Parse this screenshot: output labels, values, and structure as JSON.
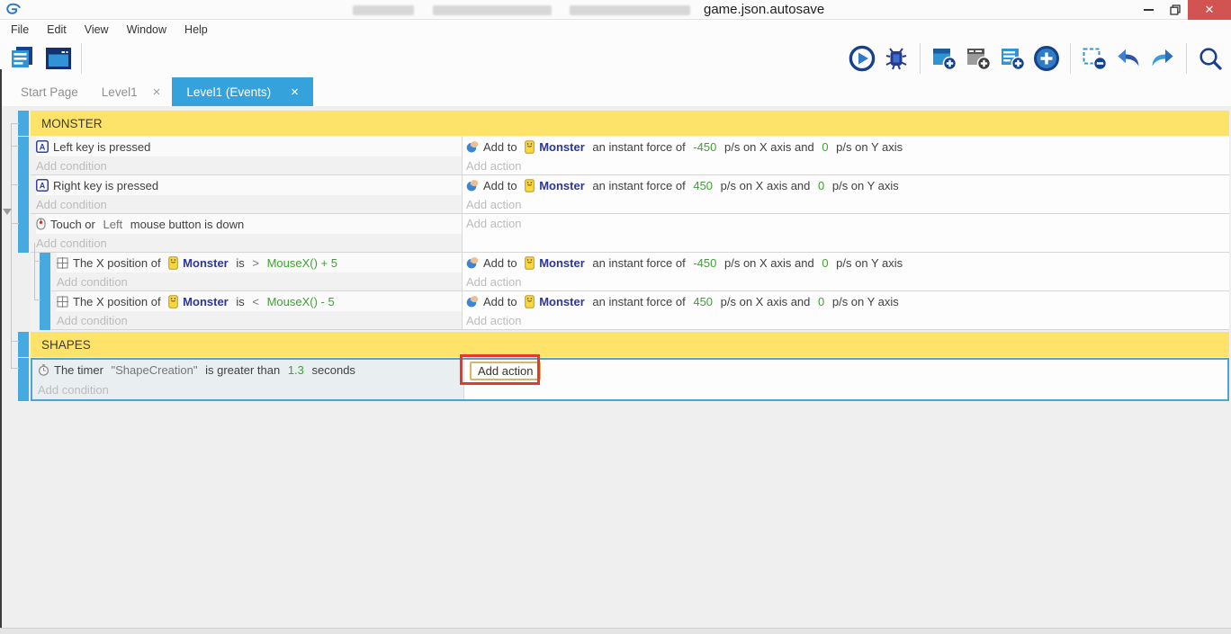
{
  "titlebar": {
    "visible_title": "game.json.autosave",
    "window_controls": [
      "minimize-icon",
      "restore-icon",
      "close-icon"
    ],
    "close_glyph": "✕"
  },
  "menubar": [
    "File",
    "Edit",
    "View",
    "Window",
    "Help"
  ],
  "toolbar": {
    "left": [
      "project-manager-icon",
      "scene-editor-icon"
    ],
    "right": [
      "play-icon",
      "debug-icon",
      "separator",
      "add-event-icon",
      "add-subevent-icon",
      "add-comment-icon",
      "add-circle-icon",
      "separator",
      "remove-event-icon",
      "undo-icon",
      "redo-icon",
      "separator",
      "search-icon"
    ]
  },
  "tabs": [
    {
      "label": "Start Page",
      "close": null,
      "active": false
    },
    {
      "label": "Level1",
      "close": "×",
      "active": false
    },
    {
      "label": "Level1 (Events)",
      "close": "×",
      "active": true
    }
  ],
  "placeholders": {
    "condition": "Add condition",
    "action": "Add action"
  },
  "colors": {
    "accent_blue": "#35a2dc",
    "event_bar_blue": "#45aadf",
    "header_yellow": "#fde36a",
    "expression_green": "#3da232",
    "object_navy": "#2c3699",
    "selection_border": "#4ba6cf",
    "annotation_red": "#e23b2e",
    "close_button_red": "#d15352"
  },
  "events": [
    {
      "kind": "header",
      "label": "MONSTER"
    },
    {
      "kind": "event",
      "cond": [
        {
          "icon": "keyboard-icon",
          "parts": [
            [
              "Left key is pressed",
              "n"
            ]
          ]
        }
      ],
      "act": [
        {
          "icon": "force-icon",
          "parts": [
            [
              "Add to ",
              "n"
            ],
            [
              "monster-icon",
              "i"
            ],
            [
              "Monster",
              "o"
            ],
            [
              " an instant force of ",
              "n"
            ],
            [
              "-450",
              "g"
            ],
            [
              " p/s on X axis and ",
              "n"
            ],
            [
              "0",
              "g"
            ],
            [
              " p/s on Y axis",
              "n"
            ]
          ]
        }
      ]
    },
    {
      "kind": "event",
      "cond": [
        {
          "icon": "keyboard-icon",
          "parts": [
            [
              "Right key is pressed",
              "n"
            ]
          ]
        }
      ],
      "act": [
        {
          "icon": "force-icon",
          "parts": [
            [
              "Add to ",
              "n"
            ],
            [
              "monster-icon",
              "i"
            ],
            [
              "Monster",
              "o"
            ],
            [
              " an instant force of ",
              "n"
            ],
            [
              "450",
              "g"
            ],
            [
              " p/s on X axis and ",
              "n"
            ],
            [
              "0",
              "g"
            ],
            [
              " p/s on Y axis",
              "n"
            ]
          ]
        }
      ]
    },
    {
      "kind": "event",
      "cond": [
        {
          "icon": "mouse-icon",
          "parts": [
            [
              "Touch or ",
              "n"
            ],
            [
              "Left",
              "p"
            ],
            [
              " mouse button is down",
              "n"
            ]
          ]
        }
      ],
      "act": []
    },
    {
      "kind": "event",
      "sub": true,
      "cond": [
        {
          "icon": "position-icon",
          "parts": [
            [
              "The X position of ",
              "n"
            ],
            [
              "monster-icon",
              "i"
            ],
            [
              "Monster",
              "o"
            ],
            [
              " is ",
              "n"
            ],
            [
              "> ",
              "p"
            ],
            [
              "MouseX() + 5",
              "g"
            ]
          ]
        }
      ],
      "act": [
        {
          "icon": "force-icon",
          "parts": [
            [
              "Add to ",
              "n"
            ],
            [
              "monster-icon",
              "i"
            ],
            [
              "Monster",
              "o"
            ],
            [
              " an instant force of ",
              "n"
            ],
            [
              "-450",
              "g"
            ],
            [
              " p/s on X axis and ",
              "n"
            ],
            [
              "0",
              "g"
            ],
            [
              " p/s on Y axis",
              "n"
            ]
          ]
        }
      ]
    },
    {
      "kind": "event",
      "sub": true,
      "cond": [
        {
          "icon": "position-icon",
          "parts": [
            [
              "The X position of ",
              "n"
            ],
            [
              "monster-icon",
              "i"
            ],
            [
              "Monster",
              "o"
            ],
            [
              " is ",
              "n"
            ],
            [
              "< ",
              "p"
            ],
            [
              "MouseX() - 5",
              "g"
            ]
          ]
        }
      ],
      "act": [
        {
          "icon": "force-icon",
          "parts": [
            [
              "Add to ",
              "n"
            ],
            [
              "monster-icon",
              "i"
            ],
            [
              "Monster",
              "o"
            ],
            [
              " an instant force of ",
              "n"
            ],
            [
              "450",
              "g"
            ],
            [
              " p/s on X axis and ",
              "n"
            ],
            [
              "0",
              "g"
            ],
            [
              " p/s on Y axis",
              "n"
            ]
          ]
        }
      ]
    },
    {
      "kind": "header",
      "label": "SHAPES",
      "gap_before": true
    },
    {
      "kind": "event",
      "selected": true,
      "focused_action": true,
      "cond": [
        {
          "icon": "timer-icon",
          "parts": [
            [
              "The timer ",
              "n"
            ],
            [
              "\"ShapeCreation\"",
              "p"
            ],
            [
              " is greater than ",
              "n"
            ],
            [
              "1.3",
              "g"
            ],
            [
              " seconds",
              "n"
            ]
          ]
        }
      ],
      "act": []
    }
  ]
}
